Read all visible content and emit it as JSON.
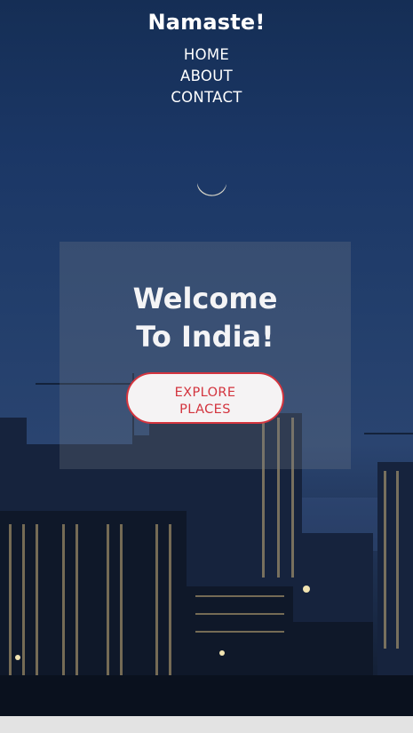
{
  "header": {
    "brand": "Namaste!"
  },
  "nav": {
    "items": [
      {
        "label": "HOME"
      },
      {
        "label": "ABOUT"
      },
      {
        "label": "CONTACT"
      }
    ]
  },
  "hero": {
    "heading_line1": "Welcome",
    "heading_line2": "To India!",
    "cta_line1": "EXPLORE",
    "cta_line2": "PLACES"
  },
  "colors": {
    "accent": "#d3343e",
    "text": "#ffffff",
    "sky": "#1b3766",
    "button_bg": "#f5f3f4",
    "page_bg": "#e3e3e3"
  },
  "icons": {
    "moon": "crescent-moon"
  }
}
